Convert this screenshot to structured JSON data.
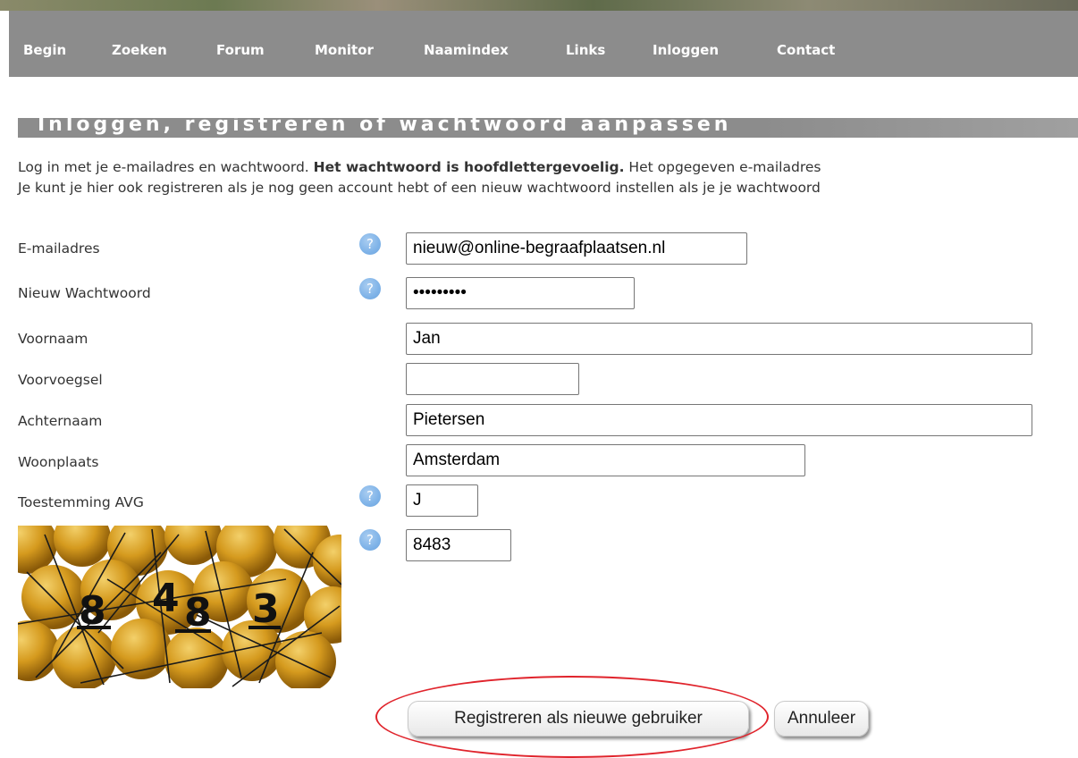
{
  "nav": {
    "items": [
      "Begin",
      "Zoeken",
      "Forum",
      "Monitor",
      "Naamindex",
      "Links",
      "Inloggen",
      "Contact"
    ]
  },
  "page": {
    "heading": "Inloggen, registreren of wachtwoord aanpassen",
    "intro_line1_a": "Log in met je e-mailadres en wachtwoord. ",
    "intro_line1_bold": "Het wachtwoord is hoofdlettergevoelig.",
    "intro_line1_b": " Het opgegeven e-mailadres",
    "intro_line2": "Je kunt je hier ook registreren als je nog geen account hebt of een nieuw wachtwoord instellen als je je wachtwoord"
  },
  "form": {
    "email_label": "E-mailadres",
    "email_value": "nieuw@online-begraafplaatsen.nl",
    "password_label": "Nieuw Wachtwoord",
    "password_value": "•••••••••",
    "firstname_label": "Voornaam",
    "firstname_value": "Jan",
    "prefix_label": "Voorvoegsel",
    "prefix_value": "",
    "lastname_label": "Achternaam",
    "lastname_value": "Pietersen",
    "city_label": "Woonplaats",
    "city_value": "Amsterdam",
    "consent_label": "Toestemming AVG",
    "consent_value": "J",
    "captcha_value": "8483",
    "captcha_text": "8483",
    "help_glyph": "?"
  },
  "buttons": {
    "register": "Registreren als nieuwe gebruiker",
    "cancel": "Annuleer"
  },
  "icons": {
    "help": "help-question-icon"
  },
  "colors": {
    "nav_bg": "#8c8c8c",
    "help_blue": "#7fb3e8",
    "annotation_red": "#e0242c"
  }
}
